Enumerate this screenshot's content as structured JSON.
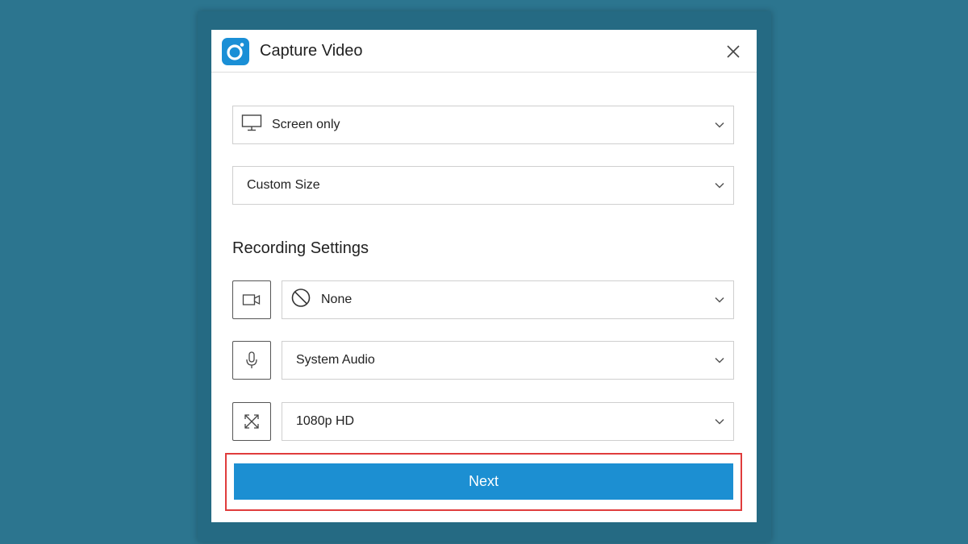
{
  "dialog": {
    "title": "Capture Video",
    "accent_color": "#1c8fd2",
    "icons": {
      "app": "camera-lens-icon",
      "close": "close-icon"
    }
  },
  "capture_source": {
    "selected": "Screen only",
    "icon": "monitor-icon"
  },
  "capture_size": {
    "selected": "Custom Size"
  },
  "recording_settings": {
    "heading": "Recording Settings",
    "camera": {
      "toggle_icon": "camera-icon",
      "status_icon": "no-entry-icon",
      "selected": "None"
    },
    "audio": {
      "toggle_icon": "microphone-icon",
      "selected": "System Audio"
    },
    "resolution": {
      "toggle_icon": "expand-icon",
      "selected": "1080p HD"
    }
  },
  "footer": {
    "next_label": "Next",
    "highlight_color": "#e03c3c"
  }
}
